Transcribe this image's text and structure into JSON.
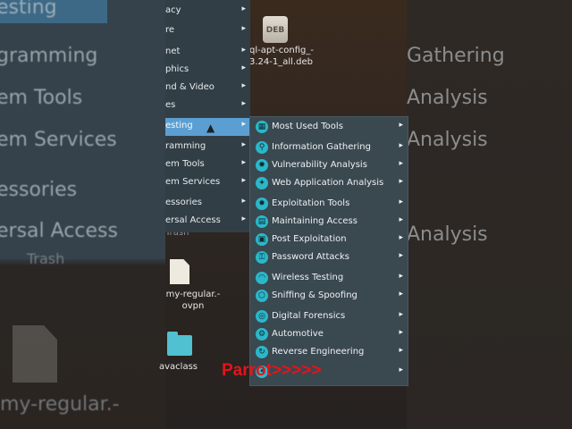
{
  "background_left": {
    "labels": [
      "esting",
      "gramming",
      "em Tools",
      "em Services",
      "essories",
      "ersal Access"
    ],
    "trash": "Trash",
    "file": "my-regular.-"
  },
  "background_right": {
    "labels": [
      "Gathering",
      "Analysis",
      "Analysis",
      "Analysis"
    ]
  },
  "desktop": {
    "deb_badge": "DEB",
    "deb_file_line1": "ql-apt-config_-",
    "deb_file_line2": "3.24-1_all.deb",
    "trash_label": "Trash",
    "file_line1": "my-regular.-",
    "file_line2": "ovpn",
    "folder_label": "avaclass"
  },
  "menu1": {
    "items": [
      {
        "label": "acy"
      },
      {
        "label": "re"
      },
      {
        "label": "net"
      },
      {
        "label": "phics"
      },
      {
        "label": "nd & Video"
      },
      {
        "label": "es"
      },
      {
        "label": "esting"
      },
      {
        "label": "ramming"
      },
      {
        "label": "em Tools"
      },
      {
        "label": "em Services"
      },
      {
        "label": "essories"
      },
      {
        "label": "ersal Access"
      }
    ],
    "arrow": "▸",
    "active_index": 6
  },
  "menu2": {
    "items": [
      {
        "label": "Most Used Tools",
        "icon": "grid-icon"
      },
      {
        "label": "Information Gathering",
        "icon": "magnifier-icon"
      },
      {
        "label": "Vulnerability Analysis",
        "icon": "bug-icon"
      },
      {
        "label": "Web Application Analysis",
        "icon": "web-icon"
      },
      {
        "label": "Exploitation Tools",
        "icon": "explosion-icon"
      },
      {
        "label": "Maintaining Access",
        "icon": "terminal-icon"
      },
      {
        "label": "Post Exploitation",
        "icon": "post-icon"
      },
      {
        "label": "Password Attacks",
        "icon": "key-icon"
      },
      {
        "label": "Wireless Testing",
        "icon": "wifi-icon"
      },
      {
        "label": "Sniffing & Spoofing",
        "icon": "network-icon"
      },
      {
        "label": "Digital Forensics",
        "icon": "fingerprint-icon"
      },
      {
        "label": "Automotive",
        "icon": "car-icon"
      },
      {
        "label": "Reverse Engineering",
        "icon": "gear-icon"
      },
      {
        "label": "",
        "icon": "more-icon"
      }
    ],
    "arrow": "▸"
  },
  "overlay_text": "Parrot>>>>>",
  "colors": {
    "menu_bg": "#323e46",
    "submenu_bg": "#3a4850",
    "highlight": "#5b9fd2",
    "icon_teal": "#2bb7c9",
    "overlay_red": "#e3141b"
  }
}
